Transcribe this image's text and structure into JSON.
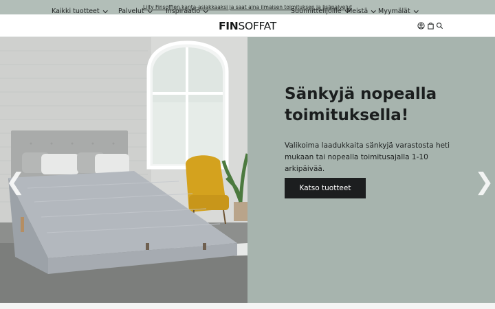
{
  "promo": {
    "text": "Liity Finsoffien kanta-asiakkaaksi ja saat aina ilmaisen toimituksen ja lisäpalvelut"
  },
  "nav_left": [
    {
      "label": "Kaikki tuotteet"
    },
    {
      "label": "Palvelut"
    },
    {
      "label": "Inspiraatio"
    }
  ],
  "logo": {
    "fin": "FIN",
    "soffat": "SOFFAT"
  },
  "nav_right": [
    {
      "label": "Suunnittelijoille"
    },
    {
      "label": "Meistä"
    },
    {
      "label": "Myymälät"
    }
  ],
  "icons": [
    "user-icon",
    "cart-icon",
    "search-icon",
    "chevron-left-icon",
    "chevron-right-icon"
  ],
  "hero": {
    "title": "Sänkyjä nopealla toimituksella!",
    "text": "Valikoima laadukkaita sänkyjä varastosta heti mukaan tai nopealla toimitusajalla 1-10 arkipäivää.",
    "button": "Katso tuotteet",
    "prev_arrow": "❮",
    "next_arrow": "❯"
  },
  "colors": {
    "promo_bg": "#b2beb8",
    "panel_bg": "#a7b4ae",
    "button_bg": "#1c1e1f"
  }
}
